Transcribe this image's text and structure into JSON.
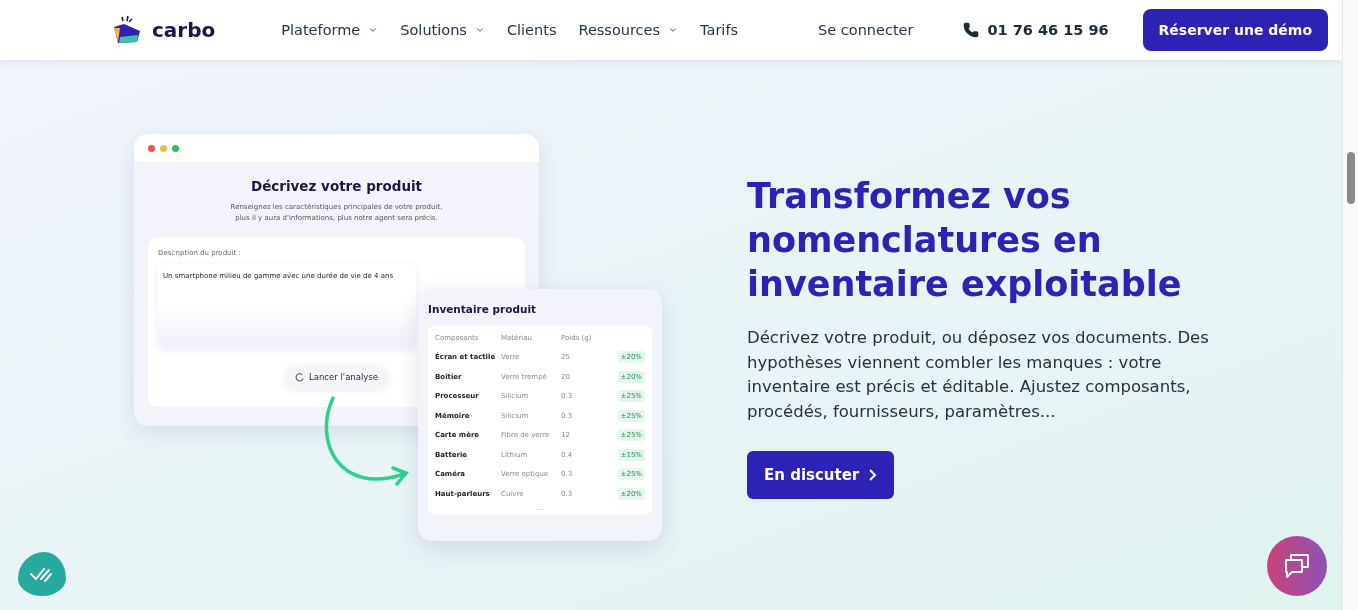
{
  "nav": {
    "brand": "carbo",
    "items": [
      {
        "label": "Plateforme",
        "dropdown": true
      },
      {
        "label": "Solutions",
        "dropdown": true
      },
      {
        "label": "Clients",
        "dropdown": false
      },
      {
        "label": "Ressources",
        "dropdown": true
      },
      {
        "label": "Tarifs",
        "dropdown": false
      }
    ],
    "login": "Se connecter",
    "phone": "01 76 46 15 96",
    "cta": "Réserver une démo"
  },
  "mockup": {
    "title": "Décrivez votre produit",
    "subtitle": "Renseignez les caractéristiques principales de votre produit,\nplus il y aura d'informations, plus notre agent sera précis.",
    "field_label": "Description du produit :",
    "field_value": "Un smartphone milieu de gamme avec une durée de vie de 4 ans",
    "button": "Lancer l'analyse"
  },
  "inventory": {
    "title": "Inventaire produit",
    "columns": [
      "Composants",
      "Matériau",
      "Poids (g)"
    ],
    "rows": [
      {
        "name": "Écran et tactile",
        "material": "Verre",
        "weight": "25",
        "margin": "±20%"
      },
      {
        "name": "Boîtier",
        "material": "Verre trempé",
        "weight": "20",
        "margin": "±20%"
      },
      {
        "name": "Processeur",
        "material": "Silicium",
        "weight": "0.3",
        "margin": "±25%"
      },
      {
        "name": "Mémoire",
        "material": "Silicium",
        "weight": "0.3",
        "margin": "±25%"
      },
      {
        "name": "Carte mère",
        "material": "Fibre de verre",
        "weight": "12",
        "margin": "±25%"
      },
      {
        "name": "Batterie",
        "material": "Lithium",
        "weight": "0,4",
        "margin": "±15%"
      },
      {
        "name": "Caméra",
        "material": "Verre optique",
        "weight": "0.3",
        "margin": "±25%"
      },
      {
        "name": "Haut-parleurs",
        "material": "Cuivre",
        "weight": "0.3",
        "margin": "±20%"
      }
    ],
    "more": "..."
  },
  "hero": {
    "title": "Transformez vos nomenclatures en inventaire exploitable",
    "text": "Décrivez votre produit, ou déposez vos documents. Des hypothèses viennent combler les manques : votre inventaire est précis et éditable. Ajustez composants, procédés, fournisseurs, paramètres...",
    "button": "En discuter"
  }
}
